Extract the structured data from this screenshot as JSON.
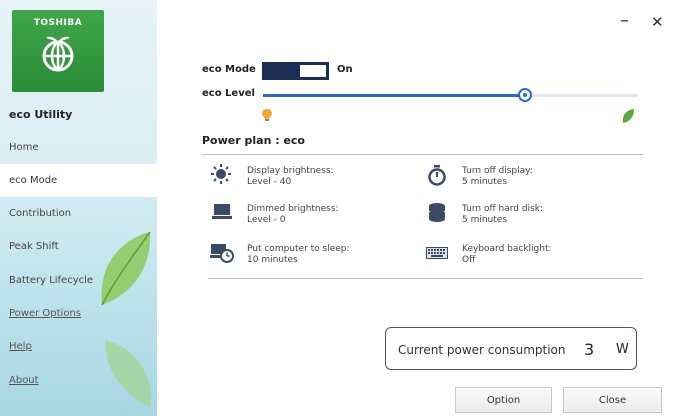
{
  "sidebar": {
    "brand": "TOSHIBA",
    "app_name": "eco Utility",
    "items": [
      {
        "label": "Home"
      },
      {
        "label": "eco Mode"
      },
      {
        "label": "Contribution"
      },
      {
        "label": "Peak Shift"
      },
      {
        "label": "Battery Lifecycle"
      },
      {
        "label": "Power Options"
      },
      {
        "label": "Help"
      },
      {
        "label": "About"
      }
    ],
    "active_item": "eco Mode"
  },
  "window": {
    "minimize_label": "–",
    "close_label": "✕"
  },
  "eco": {
    "mode_label": "eco Mode",
    "mode_state": "On",
    "level_label": "eco Level",
    "level_value": 0.7,
    "level_left_icon": "bulb-icon",
    "level_right_icon": "leaf-icon"
  },
  "power_plan": {
    "title": "Power plan : eco",
    "settings": [
      {
        "icon": "brightness-icon",
        "name": "Display brightness:",
        "value": "Level - 40"
      },
      {
        "icon": "timer-icon",
        "name": "Turn off display:",
        "value": "5 minutes"
      },
      {
        "icon": "laptop-icon",
        "name": "Dimmed brightness:",
        "value": "Level - 0"
      },
      {
        "icon": "disk-icon",
        "name": "Turn off hard disk:",
        "value": "5 minutes"
      },
      {
        "icon": "sleep-icon",
        "name": "Put computer to sleep:",
        "value": "10 minutes"
      },
      {
        "icon": "keyboard-icon",
        "name": "Keyboard backlight:",
        "value": "Off"
      }
    ]
  },
  "consumption": {
    "label": "Current power consumption",
    "value": "3",
    "unit": "W"
  },
  "buttons": {
    "option": "Option",
    "close": "Close"
  },
  "colors": {
    "toggle_bg": "#1b2f56",
    "slider": "#2a6ad0",
    "logo_green": "#3fa64a"
  }
}
